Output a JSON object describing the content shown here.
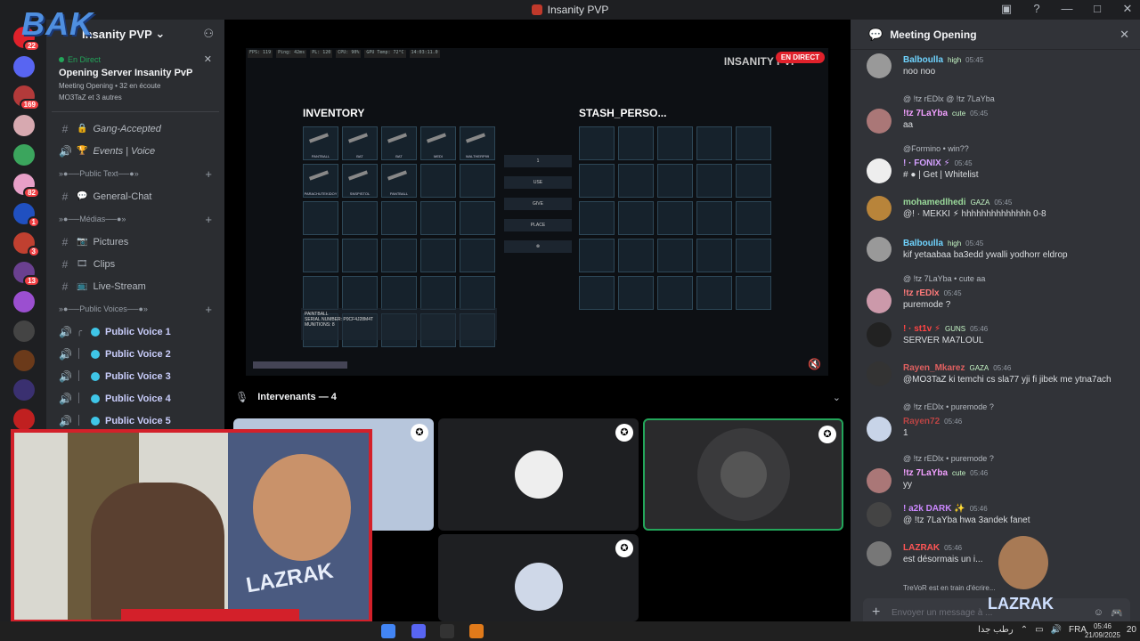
{
  "titlebar": {
    "title": "Insanity PVP",
    "controls": [
      "▣",
      "?",
      "—",
      "□",
      "✕"
    ]
  },
  "guilds": [
    {
      "badge": "22",
      "color": "#e0212b"
    },
    {
      "badge": "",
      "color": "#5865f2"
    },
    {
      "badge": "169",
      "color": "#b33a3a"
    },
    {
      "badge": "",
      "color": "#d7a9b0"
    },
    {
      "badge": "",
      "color": "#3ba55d"
    },
    {
      "badge": "82",
      "color": "#e8a0c8"
    },
    {
      "badge": "1",
      "color": "#2050c0"
    },
    {
      "badge": "3",
      "color": "#c04030"
    },
    {
      "badge": "13",
      "color": "#6a4090"
    },
    {
      "badge": "",
      "color": "#9b4fd0"
    },
    {
      "badge": "",
      "color": "#444"
    },
    {
      "badge": "",
      "color": "#6b3a1a"
    },
    {
      "badge": "",
      "color": "#3a3070"
    },
    {
      "badge": "",
      "color": "#c02020"
    }
  ],
  "server": {
    "name": "Insanity PVP",
    "overlay_text": "BAK",
    "live_card": {
      "live_label": "En Direct",
      "title": "Opening Server Insanity PvP",
      "meta": "Meeting Opening • 32 en écoute",
      "meta2": "MO3TaZ et 3 autres"
    },
    "channels": [
      {
        "type": "text",
        "emoji": "🔒",
        "label": "Gang-Accepted",
        "italic": true
      },
      {
        "type": "voice",
        "emoji": "🏆",
        "label": "Events | Voice",
        "italic": true
      }
    ],
    "categories": [
      {
        "label": "»●──Public Text──●»",
        "channels": [
          {
            "emoji": "💬",
            "label": "General-Chat"
          }
        ]
      },
      {
        "label": "»●──Médias──●»",
        "channels": [
          {
            "emoji": "📷",
            "label": "Pictures"
          },
          {
            "emoji": "🎞",
            "label": "Clips"
          },
          {
            "emoji": "📺",
            "label": "Live-Stream"
          }
        ]
      },
      {
        "label": "»●──Public Voices──●»",
        "channels": [
          {
            "label": "Public Voice 1"
          },
          {
            "label": "Public Voice 2"
          },
          {
            "label": "Public Voice 3"
          },
          {
            "label": "Public Voice 4"
          },
          {
            "label": "Public Voice 5"
          }
        ]
      }
    ]
  },
  "stream": {
    "game_title": "INSANITY PVP",
    "live_badge": "EN DIRECT",
    "hud": [
      "FPS: 119",
      "Ping: 42ms",
      "PL: 120",
      "CPU: 90%",
      "GPU Temp: 72°C",
      "14:03:11.0"
    ],
    "inventory_title": "INVENTORY",
    "stash_title": "STASH_PERSO...",
    "inventory_items": [
      "PANTBALL",
      "BAT",
      "BAT",
      "MEDI",
      "WALTHERP99",
      "PARACHUTEKIDOY",
      "SNSPISTOL",
      "PANTBALL",
      "",
      "",
      "",
      "",
      "",
      "",
      "",
      "",
      "",
      "",
      "",
      "",
      "",
      "",
      "",
      "",
      "",
      "",
      "",
      "",
      "",
      ""
    ],
    "context_menu": [
      "1",
      "USE",
      "GIVE",
      "PLACE",
      "⊗"
    ],
    "item_desc": {
      "name": "PAINTBALL",
      "line1": "SERIAL NUMBER: P0CF4J28M4T",
      "line2": "MUNITIONS: 8"
    }
  },
  "speakers": {
    "label": "Intervenants — 4"
  },
  "webcam": {
    "cartoon_label": "LAZRAK",
    "caption": ""
  },
  "chat": {
    "title": "Meeting Opening",
    "messages": [
      {
        "reply": "",
        "name": "Balboulla",
        "name_color": "#6fd4ff",
        "tag": "high",
        "time": "05:45",
        "text": "noo noo",
        "avatar": "#999"
      },
      {
        "reply": "@ !tz rEDlx @ !tz 7LaYba",
        "name": "!tz 7LaYba",
        "name_color": "#f2a0ff",
        "tag": "cute",
        "time": "05:45",
        "text": "aa",
        "avatar": "#a77"
      },
      {
        "reply": "@Formino • win??",
        "name": "! · FONIX ⚡",
        "name_color": "#d4a0ff",
        "tag": "",
        "time": "05:45",
        "text": "# ● | Get | Whitelist",
        "avatar": "#eee"
      },
      {
        "reply": "",
        "name": "mohamedlhedi",
        "name_color": "#9ad99a",
        "tag": "GAZA",
        "time": "05:45",
        "text": "@! · MEKKI ⚡ hhhhhhhhhhhhhh 0-8",
        "avatar": "#b8843a"
      },
      {
        "reply": "",
        "name": "Balboulla",
        "name_color": "#6fd4ff",
        "tag": "high",
        "time": "05:45",
        "text": "kif yetaabaa ba3edd ywalli yodhorr eldrop",
        "avatar": "#999"
      },
      {
        "reply": "@ !tz 7LaYba • cute aa",
        "name": "!tz rEDlx",
        "name_color": "#ff7a7a",
        "tag": "",
        "time": "05:45",
        "text": "puremode ?",
        "avatar": "#c9a"
      },
      {
        "reply": "",
        "name": "! · st1v ⚡",
        "name_color": "#ff4444",
        "tag": "GUNS",
        "time": "05:46",
        "text": "SERVER MA7LOUL",
        "avatar": "#222"
      },
      {
        "reply": "",
        "name": "Rayen_Mkarez",
        "name_color": "#e06060",
        "tag": "GAZA",
        "time": "05:46",
        "text": "@MO3TaZ ki temchi cs sla77 yji fi jibek me ytna7ach",
        "avatar": "#333"
      },
      {
        "reply": "@ !tz rEDlx • puremode ?",
        "name": "Rayen72",
        "name_color": "#b44",
        "tag": "",
        "time": "05:46",
        "text": "1",
        "avatar": "#c8d4e8"
      },
      {
        "reply": "@ !tz rEDlx • puremode ?",
        "name": "!tz 7LaYba",
        "name_color": "#f2a0ff",
        "tag": "cute",
        "time": "05:46",
        "text": "yy",
        "avatar": "#a77"
      },
      {
        "reply": "",
        "name": "! a2k DARK ✨",
        "name_color": "#cc88ff",
        "tag": "",
        "time": "05:46",
        "text": "@ !tz 7LaYba hwa 3andek fanet",
        "avatar": "#444"
      },
      {
        "reply": "",
        "name": "LAZRAK",
        "name_color": "#ff5555",
        "tag": "",
        "time": "05:46",
        "text": "est désormais un i...",
        "avatar": "#777"
      }
    ],
    "typing": "TreVoR est en train d'écrire...",
    "input_placeholder": "Envoyer un message à ...",
    "bot_logo_text": "LAZRAK"
  },
  "taskbar": {
    "tray_text": "رطب جدا",
    "lang": "FRA",
    "time": "05:46",
    "date": "21/09/2025",
    "notif": "20"
  },
  "colors": {
    "discord_bg": "#313338",
    "sidebar_bg": "#2b2d31",
    "accent_green": "#23a55a",
    "live_red": "#e0212b"
  }
}
